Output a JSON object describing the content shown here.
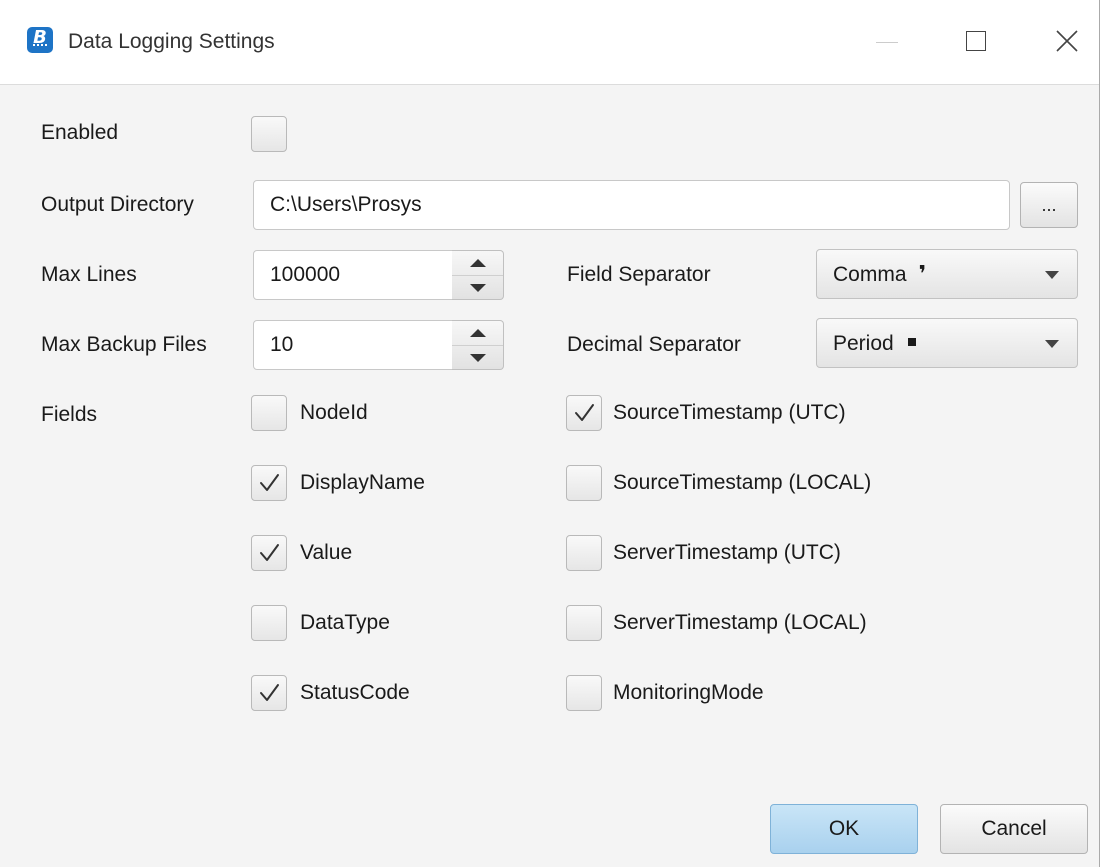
{
  "window": {
    "title": "Data Logging Settings",
    "app_icon_letter": "B"
  },
  "form": {
    "enabled_label": "Enabled",
    "enabled_checked": false,
    "output_directory_label": "Output Directory",
    "output_directory_value": "C:\\Users\\Prosys",
    "browse_button_label": "...",
    "max_lines_label": "Max Lines",
    "max_lines_value": "100000",
    "max_backup_files_label": "Max Backup Files",
    "max_backup_files_value": "10",
    "field_separator_label": "Field Separator",
    "field_separator_value": "Comma",
    "decimal_separator_label": "Decimal Separator",
    "decimal_separator_value": "Period",
    "fields_label": "Fields"
  },
  "fields_left": [
    {
      "label": "NodeId",
      "checked": false
    },
    {
      "label": "DisplayName",
      "checked": true
    },
    {
      "label": "Value",
      "checked": true
    },
    {
      "label": "DataType",
      "checked": false
    },
    {
      "label": "StatusCode",
      "checked": true
    }
  ],
  "fields_right": [
    {
      "label": "SourceTimestamp (UTC)",
      "checked": true
    },
    {
      "label": "SourceTimestamp (LOCAL)",
      "checked": false
    },
    {
      "label": "ServerTimestamp (UTC)",
      "checked": false
    },
    {
      "label": "ServerTimestamp (LOCAL)",
      "checked": false
    },
    {
      "label": "MonitoringMode",
      "checked": false
    }
  ],
  "buttons": {
    "ok_label": "OK",
    "cancel_label": "Cancel"
  },
  "colors": {
    "accent_ok": "#b9dbf2",
    "app_icon": "#1e74c6",
    "dialog_background": "#f4f4f4"
  }
}
